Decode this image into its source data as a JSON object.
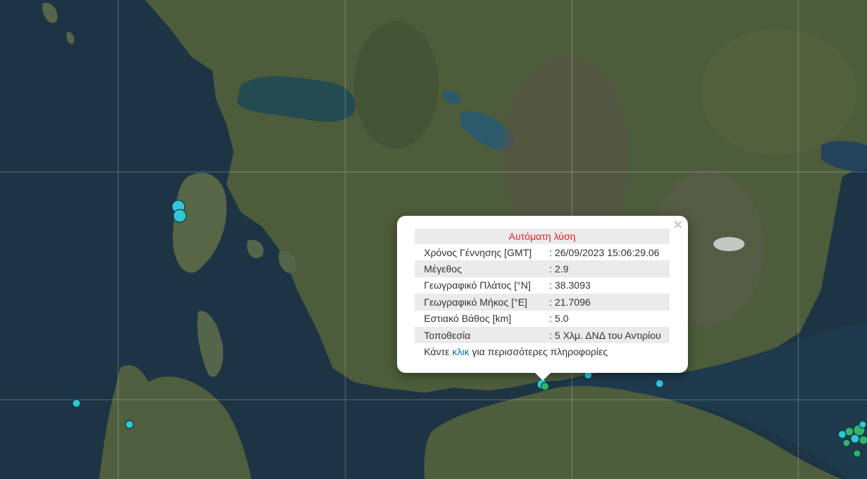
{
  "popup": {
    "title": "Αυτόματη λύση",
    "close_symbol": "×",
    "rows": [
      {
        "label": "Χρόνος Γέννησης [GMT]",
        "value": ": 26/09/2023 15:06:29.06"
      },
      {
        "label": "Μέγεθος",
        "value": ": 2.9"
      },
      {
        "label": "Γεωγραφικό Πλάτος [°N]",
        "value": ": 38.3093"
      },
      {
        "label": "Γεωγραφικό Μήκος [°E]",
        "value": ": 21.7096"
      },
      {
        "label": "Εστιακό Βάθος [km]",
        "value": ": 5.0"
      },
      {
        "label": "Τοποθεσία",
        "value": ": 5 Χλμ. ΔΝΔ του Αντιρίου"
      }
    ],
    "more_prefix": "Κάντε ",
    "more_link": "κλικ",
    "more_suffix": " για περισσότερες πληροφορίες"
  },
  "colors": {
    "sea": "#1d3444",
    "land": "#4a5a38",
    "quake_cyan": "#31c6d9",
    "quake_green": "#2fb56a",
    "popup_title": "#e8202a",
    "link": "#0078a8"
  }
}
